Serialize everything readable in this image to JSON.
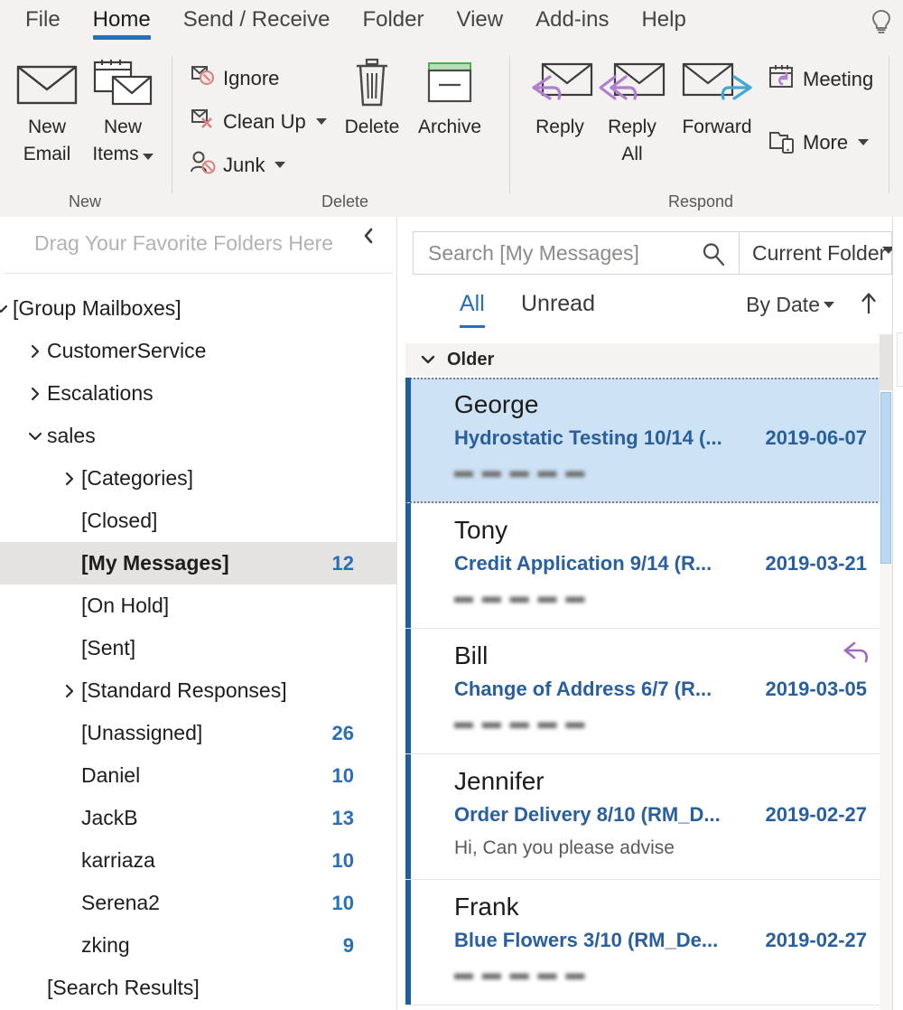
{
  "ribbon": {
    "tabs": [
      {
        "label": "File",
        "active": false
      },
      {
        "label": "Home",
        "active": true
      },
      {
        "label": "Send / Receive",
        "active": false
      },
      {
        "label": "Folder",
        "active": false
      },
      {
        "label": "View",
        "active": false
      },
      {
        "label": "Add-ins",
        "active": false
      },
      {
        "label": "Help",
        "active": false
      }
    ],
    "help_icon": "lightbulb-icon",
    "groups": {
      "new": {
        "label": "New",
        "buttons": [
          {
            "line1": "New",
            "line2": "Email",
            "icon": "envelope-icon"
          },
          {
            "line1": "New",
            "line2": "Items",
            "icon": "calendar-envelope-icon",
            "dropdown": true
          }
        ]
      },
      "delete": {
        "label": "Delete",
        "small_buttons": [
          {
            "label": "Ignore",
            "icon": "ignore-icon",
            "dropdown": false
          },
          {
            "label": "Clean Up",
            "icon": "clean-up-icon",
            "dropdown": true
          },
          {
            "label": "Junk",
            "icon": "junk-person-icon",
            "dropdown": true
          }
        ],
        "big_buttons": [
          {
            "line1": "Delete",
            "line2": "",
            "icon": "trash-icon"
          },
          {
            "line1": "Archive",
            "line2": "",
            "icon": "archive-box-icon"
          }
        ]
      },
      "respond": {
        "label": "Respond",
        "big_buttons": [
          {
            "line1": "Reply",
            "line2": "",
            "icon": "reply-icon"
          },
          {
            "line1": "Reply",
            "line2": "All",
            "icon": "reply-all-icon"
          },
          {
            "line1": "Forward",
            "line2": "",
            "icon": "forward-icon"
          }
        ],
        "small_buttons": [
          {
            "label": "Meeting",
            "icon": "meeting-calendar-icon",
            "dropdown": false
          },
          {
            "label": "More",
            "icon": "more-devices-icon",
            "dropdown": true
          }
        ]
      }
    }
  },
  "folder_pane": {
    "favorites_hint": "Drag Your Favorite Folders Here",
    "collapse_icon": "chevron-left-icon",
    "items": [
      {
        "label": "[Group Mailboxes]",
        "indent": 0,
        "caret": "down",
        "count": "",
        "selected": false
      },
      {
        "label": "CustomerService",
        "indent": 1,
        "caret": "right",
        "count": "",
        "selected": false
      },
      {
        "label": "Escalations",
        "indent": 1,
        "caret": "right",
        "count": "",
        "selected": false
      },
      {
        "label": "sales",
        "indent": 1,
        "caret": "down",
        "count": "",
        "selected": false
      },
      {
        "label": "[Categories]",
        "indent": 2,
        "caret": "right",
        "count": "",
        "selected": false
      },
      {
        "label": "[Closed]",
        "indent": 2,
        "caret": "none",
        "count": "",
        "selected": false
      },
      {
        "label": "[My Messages]",
        "indent": 2,
        "caret": "none",
        "count": "12",
        "selected": true
      },
      {
        "label": "[On Hold]",
        "indent": 2,
        "caret": "none",
        "count": "",
        "selected": false
      },
      {
        "label": "[Sent]",
        "indent": 2,
        "caret": "none",
        "count": "",
        "selected": false
      },
      {
        "label": "[Standard Responses]",
        "indent": 2,
        "caret": "right",
        "count": "",
        "selected": false
      },
      {
        "label": "[Unassigned]",
        "indent": 2,
        "caret": "none",
        "count": "26",
        "selected": false
      },
      {
        "label": "Daniel",
        "indent": 2,
        "caret": "none",
        "count": "10",
        "selected": false
      },
      {
        "label": "JackB",
        "indent": 2,
        "caret": "none",
        "count": "13",
        "selected": false
      },
      {
        "label": "karriaza",
        "indent": 2,
        "caret": "none",
        "count": "10",
        "selected": false
      },
      {
        "label": "Serena2",
        "indent": 2,
        "caret": "none",
        "count": "10",
        "selected": false
      },
      {
        "label": "zking",
        "indent": 2,
        "caret": "none",
        "count": "9",
        "selected": false
      },
      {
        "label": "[Search Results]",
        "indent": 1,
        "caret": "none",
        "count": "",
        "selected": false
      }
    ]
  },
  "list_pane": {
    "search": {
      "placeholder": "Search [My Messages]",
      "value": "",
      "icon": "search-icon"
    },
    "scope": {
      "value": "Current Folder",
      "icon": "chevron-down-icon"
    },
    "filters": [
      {
        "label": "All",
        "active": true
      },
      {
        "label": "Unread",
        "active": false
      }
    ],
    "sort": {
      "label": "By Date",
      "icon": "chevron-down-icon"
    },
    "sort_direction_icon": "arrow-up-icon",
    "group_header": {
      "label": "Older",
      "caret": "chevron-down-icon"
    },
    "messages": [
      {
        "sender": "George",
        "subject": "Hydrostatic Testing 10/14 (...",
        "date": "2019-06-07",
        "preview": "▬ ▬ ▬ ▬ ▬",
        "preview_redacted": true,
        "selected": true,
        "unread": true,
        "replied": false
      },
      {
        "sender": "Tony",
        "subject": "Credit Application 9/14 (R...",
        "date": "2019-03-21",
        "preview": "▬ ▬ ▬ ▬ ▬",
        "preview_redacted": true,
        "selected": false,
        "unread": true,
        "replied": false
      },
      {
        "sender": "Bill",
        "subject": "Change of Address 6/7 (R...",
        "date": "2019-03-05",
        "preview": "▬ ▬ ▬ ▬ ▬",
        "preview_redacted": true,
        "selected": false,
        "unread": true,
        "replied": true
      },
      {
        "sender": "Jennifer",
        "subject": "Order Delivery 8/10 (RM_D...",
        "date": "2019-02-27",
        "preview": "Hi,   Can you please advise",
        "preview_redacted": false,
        "selected": false,
        "unread": true,
        "replied": false
      },
      {
        "sender": "Frank",
        "subject": "Blue Flowers 3/10 (RM_De...",
        "date": "2019-02-27",
        "preview": "▬ ▬ ▬ ▬ ▬",
        "preview_redacted": true,
        "selected": false,
        "unread": true,
        "replied": false
      }
    ]
  },
  "colors": {
    "accent_blue": "#2a6fb5",
    "unread_bar": "#1e5fa0",
    "selection_bg": "#cde3f5",
    "subject_blue": "#2a5f9e",
    "ribbon_bg": "#f3f2f1",
    "archive_green": "#4caf50",
    "reply_purple": "#9b63b5",
    "forward_blue": "#2196c9",
    "junk_red": "#e08a8a"
  }
}
